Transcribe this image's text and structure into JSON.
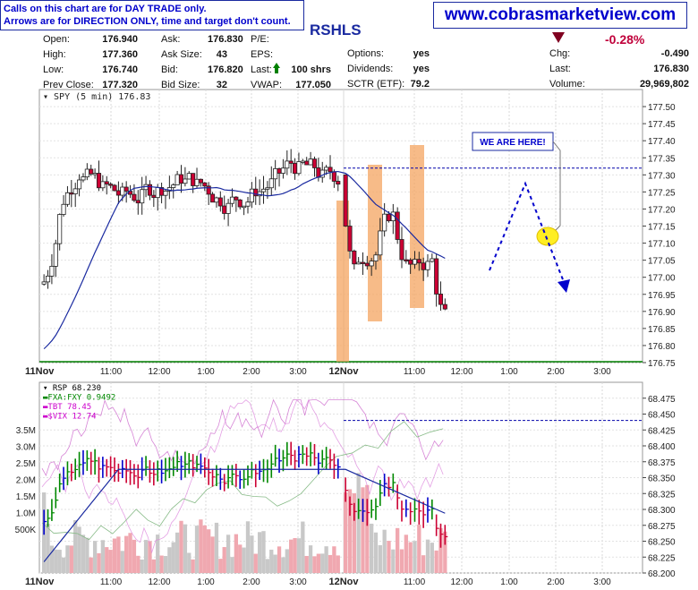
{
  "header": {
    "disclaimer_line1": "Calls on this chart are for DAY TRADE only.",
    "disclaimer_line2": "Arrows are for DIRECTION ONLY, time and target don't count.",
    "website": "www.cobrasmarketview.com",
    "ticker_fragment": "RSHLS",
    "change_pct": "-0.28%",
    "change_direction": "down"
  },
  "quote": {
    "col1": [
      {
        "label": "Open:",
        "value": "176.940"
      },
      {
        "label": "High:",
        "value": "177.360"
      },
      {
        "label": "Low:",
        "value": "176.740"
      },
      {
        "label": "Prev Close:",
        "value": "177.320"
      }
    ],
    "col2": [
      {
        "label": "Ask:",
        "value": "176.830"
      },
      {
        "label": "Ask Size:",
        "value": "43"
      },
      {
        "label": "Bid:",
        "value": "176.820"
      },
      {
        "label": "Bid Size:",
        "value": "32"
      }
    ],
    "col3": [
      {
        "label": "P/E:",
        "value": ""
      },
      {
        "label": "EPS:",
        "value": ""
      },
      {
        "label": "Last:",
        "value": "100 shrs"
      },
      {
        "label": "VWAP:",
        "value": "177.050"
      }
    ],
    "col4": [
      {
        "label": "Options:",
        "value": "yes"
      },
      {
        "label": "Dividends:",
        "value": "yes"
      },
      {
        "label": "SCTR (ETF):",
        "value": "79.2"
      }
    ],
    "col5": [
      {
        "label": "Chg:",
        "value": "-0.490"
      },
      {
        "label": "Last:",
        "value": "176.830"
      },
      {
        "label": "Volume:",
        "value": "29,969,802"
      }
    ]
  },
  "chart_data": [
    {
      "type": "candlestick",
      "title": "SPY (5 min) 176.83",
      "ylim": [
        176.75,
        177.55
      ],
      "yticks": [
        "177.50",
        "177.45",
        "177.40",
        "177.35",
        "177.30",
        "177.25",
        "177.20",
        "177.15",
        "177.10",
        "177.05",
        "177.00",
        "176.95",
        "176.90",
        "176.85",
        "176.80",
        "176.75"
      ],
      "xticks": [
        "11Nov",
        "11:00",
        "12:00",
        "1:00",
        "2:00",
        "3:00",
        "12Nov",
        "11:00",
        "12:00",
        "1:00",
        "2:00",
        "3:00"
      ],
      "prev_close_line": 177.32,
      "moving_average_visible": true,
      "annotation": "WE ARE HERE!",
      "projection_arrow": "up then down (dotted blue)",
      "highlighted_zones": 3,
      "approx_range_day1": [
        176.85,
        177.5
      ],
      "approx_range_day2": [
        176.75,
        177.36
      ]
    },
    {
      "type": "line+volume",
      "title": "RSP 68.230",
      "series": [
        {
          "name": "RSP 68.230",
          "color": "#000000"
        },
        {
          "name": "FXA:FXY 0.9492",
          "color": "#008800"
        },
        {
          "name": "TBT 78.45",
          "color": "#cc00cc"
        },
        {
          "name": "$VIX 12.74",
          "color": "#cc00cc"
        }
      ],
      "ylim": [
        68.2,
        68.5
      ],
      "yticks": [
        "68.475",
        "68.450",
        "68.425",
        "68.400",
        "68.375",
        "68.350",
        "68.325",
        "68.300",
        "68.275",
        "68.250",
        "68.225",
        "68.200"
      ],
      "volume_ticks": [
        "3.5M",
        "3.0M",
        "2.5M",
        "2.0M",
        "1.5M",
        "1.0M",
        "500K"
      ],
      "xticks": [
        "11Nov",
        "11:00",
        "12:00",
        "1:00",
        "2:00",
        "3:00",
        "12Nov",
        "11:00",
        "12:00",
        "1:00",
        "2:00",
        "3:00"
      ],
      "prev_close_line": 68.44
    }
  ],
  "colors": {
    "up": "#ffffff",
    "down": "#cc0033",
    "ma": "#1a2aa0",
    "highlight": "#f4a460",
    "grid": "#d8d8d8"
  }
}
